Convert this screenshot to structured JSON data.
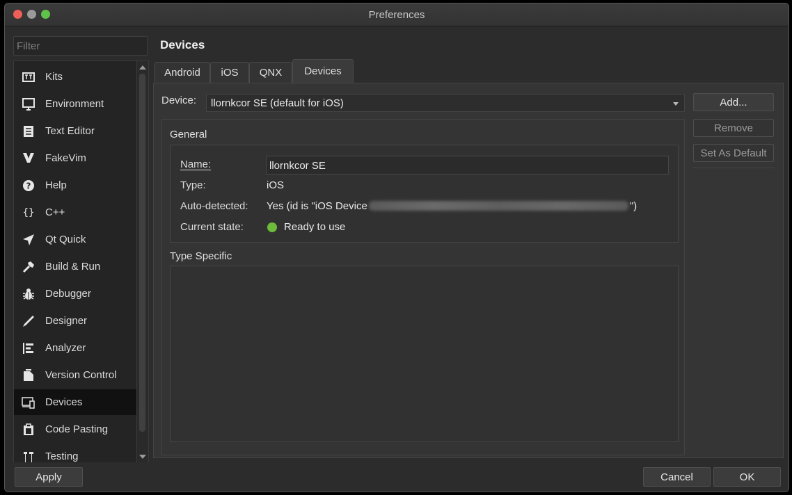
{
  "window": {
    "title": "Preferences"
  },
  "filter": {
    "placeholder": "Filter"
  },
  "sidebar": {
    "items": [
      {
        "label": "Kits",
        "icon": "kits-icon"
      },
      {
        "label": "Environment",
        "icon": "monitor-icon"
      },
      {
        "label": "Text Editor",
        "icon": "text-editor-icon"
      },
      {
        "label": "FakeVim",
        "icon": "fakevim-icon"
      },
      {
        "label": "Help",
        "icon": "help-icon"
      },
      {
        "label": "C++",
        "icon": "cpp-braces-icon"
      },
      {
        "label": "Qt Quick",
        "icon": "qt-quick-icon"
      },
      {
        "label": "Build & Run",
        "icon": "hammer-icon"
      },
      {
        "label": "Debugger",
        "icon": "bug-icon"
      },
      {
        "label": "Designer",
        "icon": "pen-icon"
      },
      {
        "label": "Analyzer",
        "icon": "analyzer-icon"
      },
      {
        "label": "Version Control",
        "icon": "version-control-icon"
      },
      {
        "label": "Devices",
        "icon": "devices-icon"
      },
      {
        "label": "Code Pasting",
        "icon": "clipboard-icon"
      },
      {
        "label": "Testing",
        "icon": "testing-icon"
      }
    ],
    "selected": "Devices"
  },
  "page": {
    "title": "Devices"
  },
  "tabs": [
    "Android",
    "iOS",
    "QNX",
    "Devices"
  ],
  "active_tab": "Devices",
  "device_row": {
    "label": "Device:",
    "selected": "llornkcor SE (default for iOS)"
  },
  "side_buttons": {
    "add": "Add...",
    "remove": "Remove",
    "set_default": "Set As Default"
  },
  "general": {
    "title": "General",
    "name_label": "Name:",
    "name_value": "llornkcor SE",
    "type_label": "Type:",
    "type_value": "iOS",
    "auto_label": "Auto-detected:",
    "auto_value_prefix": "Yes (id is \"iOS Device",
    "auto_value_suffix": "\")",
    "state_label": "Current state:",
    "state_value": "Ready to use",
    "state_color": "#6dbb3a"
  },
  "type_specific": {
    "title": "Type Specific"
  },
  "footer": {
    "apply": "Apply",
    "cancel": "Cancel",
    "ok": "OK"
  }
}
